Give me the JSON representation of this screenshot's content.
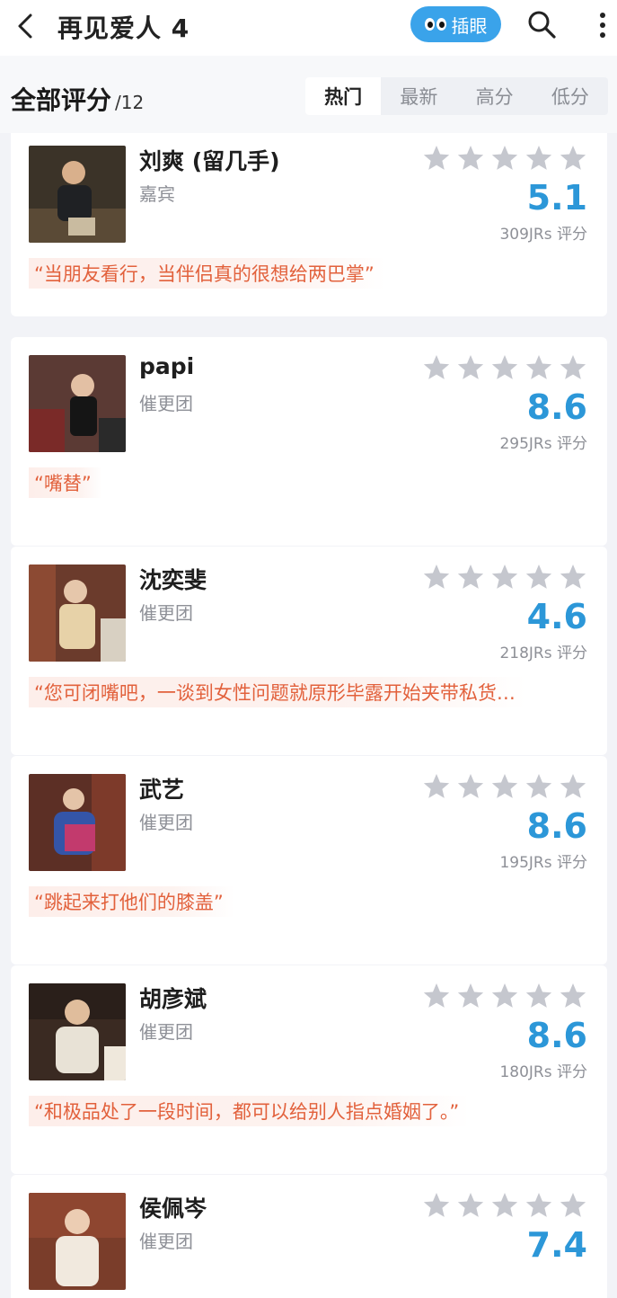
{
  "header": {
    "title": "再见爱人 4",
    "peek_label": "插眼"
  },
  "section": {
    "title": "全部评分",
    "count": "/12",
    "sort_tabs": [
      "热门",
      "最新",
      "高分",
      "低分"
    ],
    "active_tab": "热门"
  },
  "cards": [
    {
      "name": "刘爽 (留几手)",
      "role": "嘉宾",
      "score": "5.1",
      "votes": "309JRs 评分",
      "quote": "“当朋友看行，当伴侣真的很想给两巴掌”",
      "stars_filled": 0
    },
    {
      "name": "papi",
      "role": "催更团",
      "score": "8.6",
      "votes": "295JRs 评分",
      "quote": "“嘴替”",
      "stars_filled": 0
    },
    {
      "name": "沈奕斐",
      "role": "催更团",
      "score": "4.6",
      "votes": "218JRs 评分",
      "quote": "“您可闭嘴吧，一谈到女性问题就原形毕露开始夹带私货…",
      "stars_filled": 0
    },
    {
      "name": "武艺",
      "role": "催更团",
      "score": "8.6",
      "votes": "195JRs 评分",
      "quote": "“跳起来打他们的膝盖”",
      "stars_filled": 0
    },
    {
      "name": "胡彦斌",
      "role": "催更团",
      "score": "8.6",
      "votes": "180JRs 评分",
      "quote": "“和极品处了一段时间，都可以给别人指点婚姻了。”",
      "stars_filled": 0
    },
    {
      "name": "侯佩岑",
      "role": "催更团",
      "score": "7.4",
      "votes": "",
      "quote": "",
      "stars_filled": 0
    }
  ],
  "colors": {
    "accent_blue": "#2c97d8",
    "button_blue": "#3aa3ea",
    "quote_text": "#e2613c",
    "star_empty": "#c5c7ce"
  },
  "icons": [
    "back-icon",
    "eyes-icon",
    "search-icon",
    "more-icon",
    "star-icon"
  ]
}
